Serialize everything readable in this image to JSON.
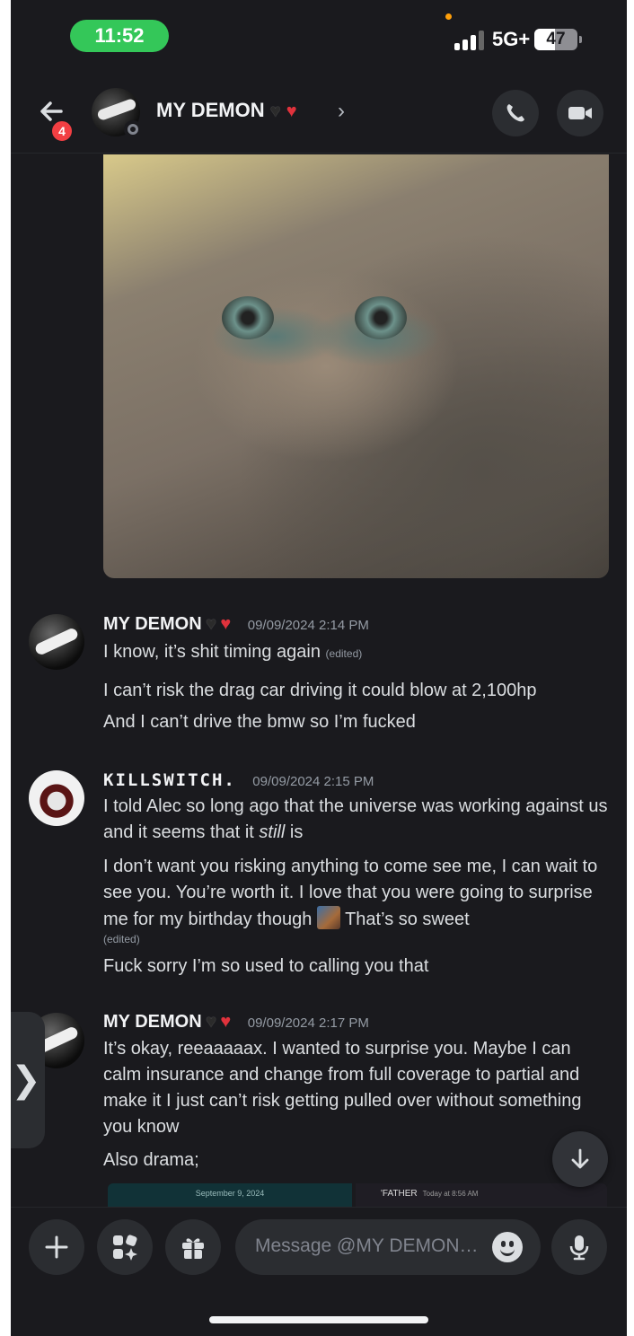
{
  "status_bar": {
    "time": "11:52",
    "network": "5G+",
    "battery": "47",
    "battery_level": 0.47
  },
  "header": {
    "unread_count": "4",
    "contact_name": "MY DEMON",
    "chevron": "›"
  },
  "messages": [
    {
      "author": "MY DEMON",
      "timestamp": "09/09/2024 2:14 PM",
      "lines": [
        {
          "text": "I know, it’s shit timing again",
          "edited": "(edited)"
        },
        {
          "text": "I can’t risk the drag car driving it could blow at 2,100hp"
        },
        {
          "text": "And I can’t drive the bmw so I’m fucked"
        }
      ]
    },
    {
      "author": "KILLSWITCH.",
      "timestamp": "09/09/2024 2:15 PM",
      "lines": [
        {
          "text_before": "I told Alec so long ago that the universe was working against us and it seems that it ",
          "emphasis": "still",
          "text_after": " is"
        },
        {
          "text_before": "I don’t want you risking anything to come see me, I can wait to see you. You’re worth it. I love that you were going to surprise me for my birthday though ",
          "text_after": " That’s so sweet",
          "edited": "(edited)"
        },
        {
          "text": "Fuck sorry I’m so used to calling you that"
        }
      ]
    },
    {
      "author": "MY DEMON",
      "timestamp": "09/09/2024 2:17 PM",
      "lines": [
        {
          "text": "It’s okay, reeaaaaax. I wanted to surprise you. Maybe I can calm insurance and change from full coverage to partial and make it I just can’t risk getting pulled over without something you know"
        },
        {
          "text": "Also drama;"
        }
      ]
    }
  ],
  "embed_preview": {
    "left_text": "September 9, 2024",
    "right_author": "'FATHER",
    "right_time": "Today at 8:56 AM"
  },
  "side_tab": {
    "glyph": "❯"
  },
  "composer": {
    "placeholder": "Message @MY DEMON…"
  },
  "colors": {
    "background": "#1a1a1e",
    "surface": "#2b2d31",
    "time_pill": "#34c759",
    "badge": "#f23f43",
    "heart_red": "#e0323c"
  }
}
